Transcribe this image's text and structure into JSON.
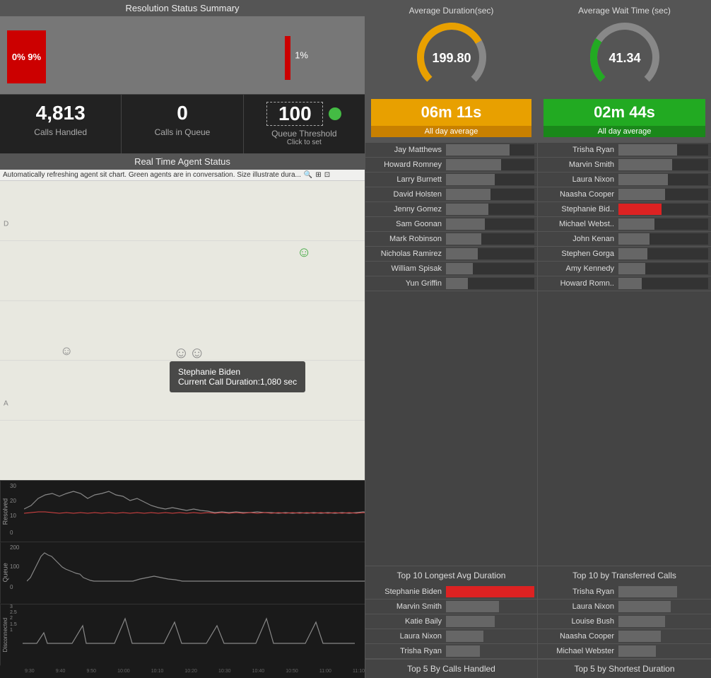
{
  "left": {
    "resolution_title": "Resolution Status Summary",
    "bar_label_left": "0% 9%",
    "bar_label_right": "1%",
    "calls_handled": {
      "value": "4,813",
      "label": "Calls Handled"
    },
    "calls_in_queue": {
      "value": "0",
      "label": "Calls in Queue"
    },
    "queue_threshold": {
      "value": "100",
      "label": "Queue Threshold",
      "sub": "Click to set"
    },
    "agent_title": "Real Time Agent Status",
    "agent_subtitle": "Automatically refreshing agent sit chart. Green agents are in conversation. Size illustrate dura...",
    "tooltip_name": "Stephanie Biden",
    "tooltip_duration": "Current Call Duration:1,080 sec"
  },
  "middle": {
    "avg_duration_title": "Average Duration(sec)",
    "avg_duration_value": "199.80",
    "avg_duration_time": "06m 11s",
    "avg_duration_label": "All day average",
    "agents": [
      {
        "name": "Jay Matthews",
        "pct": 72,
        "red": false
      },
      {
        "name": "Howard Romney",
        "pct": 62,
        "red": false
      },
      {
        "name": "Larry Burnett",
        "pct": 55,
        "red": false
      },
      {
        "name": "David Holsten",
        "pct": 50,
        "red": false
      },
      {
        "name": "Jenny Gomez",
        "pct": 48,
        "red": false
      },
      {
        "name": "Sam Goonan",
        "pct": 44,
        "red": false
      },
      {
        "name": "Mark Robinson",
        "pct": 40,
        "red": false
      },
      {
        "name": "Nicholas Ramirez",
        "pct": 36,
        "red": false
      },
      {
        "name": "William Spisak",
        "pct": 30,
        "red": false
      },
      {
        "name": "Yun Griffin",
        "pct": 25,
        "red": false
      }
    ],
    "top10_btn": "Top 10 Longest Avg Duration",
    "top5_agents": [
      {
        "name": "Stephanie Biden",
        "pct": 100,
        "red": true
      },
      {
        "name": "Marvin Smith",
        "pct": 60,
        "red": false
      },
      {
        "name": "Katie Baily",
        "pct": 55,
        "red": false
      },
      {
        "name": "Laura Nixon",
        "pct": 42,
        "red": false
      },
      {
        "name": "Trisha Ryan",
        "pct": 38,
        "red": false
      }
    ],
    "top5_btn": "Top 5 By Calls Handled"
  },
  "right": {
    "avg_wait_title": "Average Wait Time (sec)",
    "avg_wait_value": "41.34",
    "avg_wait_time": "02m 44s",
    "avg_wait_label": "All day average",
    "agents": [
      {
        "name": "Trisha Ryan",
        "pct": 65,
        "red": false
      },
      {
        "name": "Marvin Smith",
        "pct": 60,
        "red": false
      },
      {
        "name": "Laura Nixon",
        "pct": 55,
        "red": false
      },
      {
        "name": "Naasha Cooper",
        "pct": 52,
        "red": false
      },
      {
        "name": "Stephanie Bid..",
        "pct": 48,
        "red": true
      },
      {
        "name": "Michael Webst..",
        "pct": 40,
        "red": false
      },
      {
        "name": "John Kenan",
        "pct": 35,
        "red": false
      },
      {
        "name": "Stephen Gorga",
        "pct": 32,
        "red": false
      },
      {
        "name": "Amy Kennedy",
        "pct": 30,
        "red": false
      },
      {
        "name": "Howard Romn..",
        "pct": 26,
        "red": false
      }
    ],
    "top10_btn": "Top 10 by Transferred Calls",
    "top5_agents": [
      {
        "name": "Trisha Ryan",
        "pct": 65,
        "red": false
      },
      {
        "name": "Laura Nixon",
        "pct": 58,
        "red": false
      },
      {
        "name": "Louise Bush",
        "pct": 52,
        "red": false
      },
      {
        "name": "Naasha Cooper",
        "pct": 47,
        "red": false
      },
      {
        "name": "Michael Webster",
        "pct": 42,
        "red": false
      }
    ],
    "top5_btn": "Top 5 by Shortest Duration"
  },
  "chart": {
    "y_labels_resolved": [
      "30",
      "20",
      "10",
      "0"
    ],
    "y_labels_queue": [
      "200",
      "100",
      "0"
    ],
    "y_labels_disconnected": [
      "3",
      "2.5",
      "2",
      "1.5",
      "1"
    ],
    "section_labels": [
      "Resolved",
      "Queue",
      "Disconnected"
    ]
  }
}
